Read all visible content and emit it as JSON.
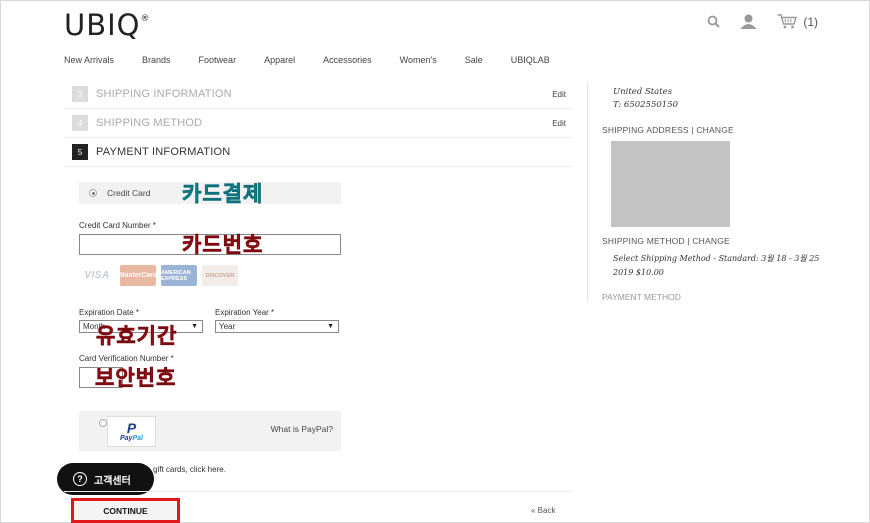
{
  "brand": {
    "logo_text": "UBIQ",
    "logo_mark": "®"
  },
  "header": {
    "cart_count": "(1)"
  },
  "nav": {
    "items": [
      "New Arrivals",
      "Brands",
      "Footwear",
      "Apparel",
      "Accessories",
      "Women's",
      "Sale",
      "UBIQLAB"
    ]
  },
  "steps": [
    {
      "num": "3",
      "title": "SHIPPING INFORMATION",
      "edit": "Edit"
    },
    {
      "num": "4",
      "title": "SHIPPING METHOD",
      "edit": "Edit"
    },
    {
      "num": "5",
      "title": "PAYMENT INFORMATION",
      "edit": ""
    }
  ],
  "payment": {
    "credit_card_label": "Credit Card",
    "card_number_label": "Credit Card Number *",
    "card_number_value": "",
    "card_logos": [
      "VISA",
      "MasterCard",
      "AMERICAN EXPRESS",
      "DISCOVER"
    ],
    "exp_date_label": "Expiration Date *",
    "exp_month_value": "Month",
    "exp_year_label": "Expiration Year *",
    "exp_year_value": "Year",
    "cvv_label": "Card Verification Number *",
    "cvv_value": "",
    "paypal_icon": "P",
    "paypal_brand_a": "Pay",
    "paypal_brand_b": "Pal",
    "paypal_link": "What is PayPal?",
    "gift_text": "gift cards, click here."
  },
  "annotations": {
    "card_payment": "카드결제",
    "card_number": "카드번호",
    "expiry": "유효기간",
    "security_code": "보안번호"
  },
  "support": {
    "label": "고객센터",
    "icon_glyph": "?"
  },
  "actions": {
    "continue_label": "CONTINUE",
    "back_label": "« Back"
  },
  "sidebar": {
    "country": "United States",
    "phone": "T: 6502550150",
    "shipping_address_head": "SHIPPING ADDRESS | CHANGE",
    "shipping_method_head": "SHIPPING METHOD | CHANGE",
    "shipping_method_text": "Select Shipping Method - Standard: 3월 18 - 3월 25 2019 $10.00",
    "payment_method_head": "PAYMENT METHOD"
  },
  "colors": {
    "highlight_border": "#e0191c",
    "annotation_teal": "#1eaab8",
    "annotation_red": "#c8141e"
  }
}
